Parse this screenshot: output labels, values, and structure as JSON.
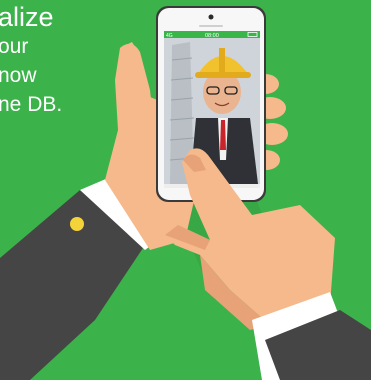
{
  "headline": {
    "line1": "alize",
    "line2": "our",
    "line3": "now",
    "line4": "ne DB."
  },
  "phone": {
    "network": "4G",
    "time": "08:00",
    "photo_subject": "child-in-hard-hat"
  },
  "colors": {
    "background": "#3cb24b",
    "phone_body": "#f7f7f7",
    "phone_bezel": "#3a3a3a",
    "skin": "#f5b98b",
    "skin_shadow": "#e7a377",
    "sleeve": "#454545",
    "cuff": "#ffffff",
    "button": "#f4d33a",
    "hard_hat": "#f2c12e"
  }
}
